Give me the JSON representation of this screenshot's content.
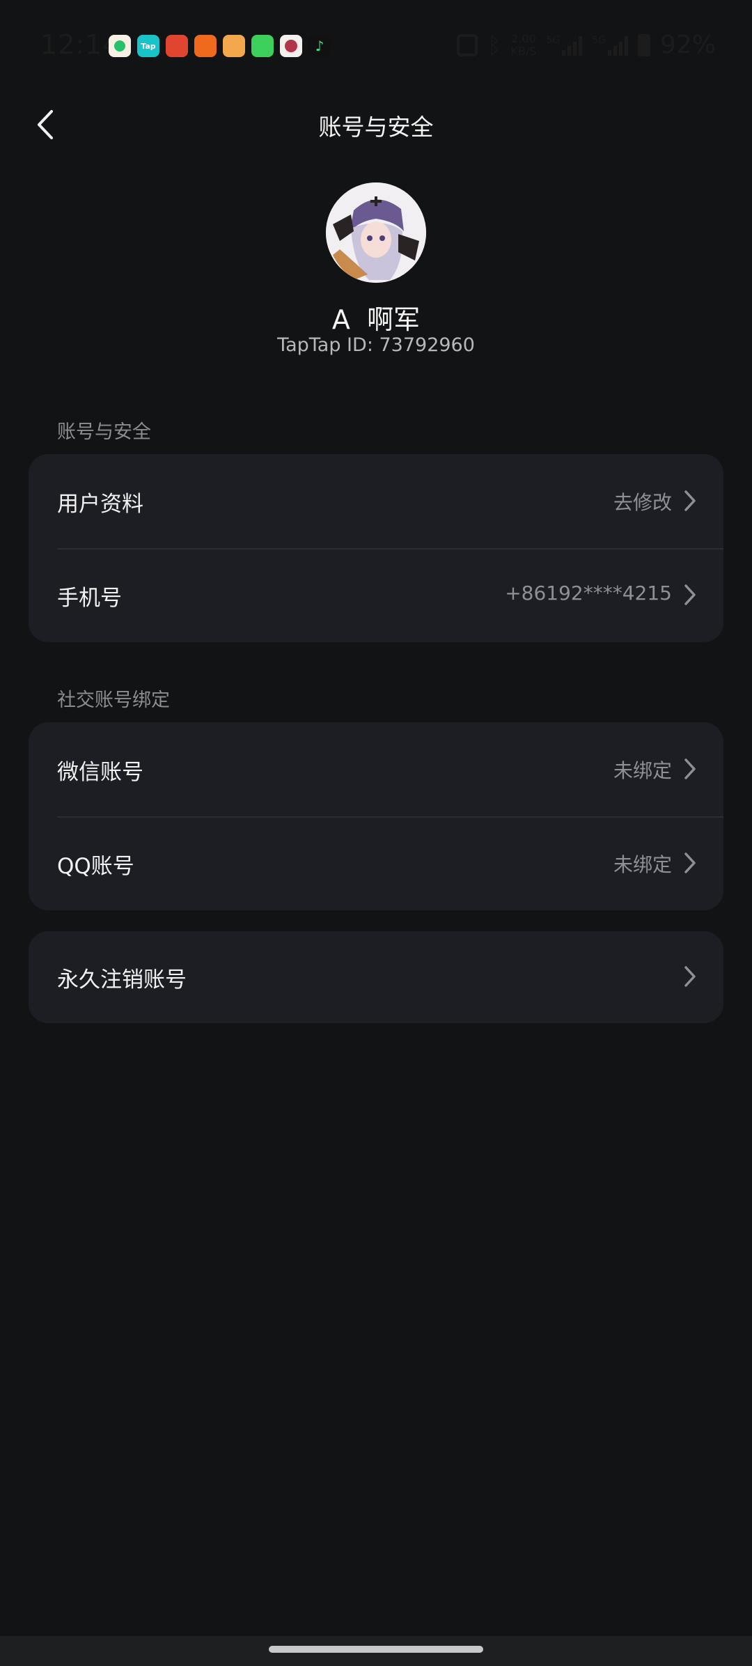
{
  "status_bar": {
    "time": "12:14",
    "network_speed": "2.00",
    "network_speed_unit": "KB/S",
    "sim1_type": "5G",
    "sim2_type": "5G",
    "battery": "92%"
  },
  "header": {
    "title": "账号与安全"
  },
  "profile": {
    "name": "A  啊军",
    "taptap_id": "TapTap ID: 73792960"
  },
  "sections": {
    "account": {
      "label": "账号与安全",
      "items": [
        {
          "label": "用户资料",
          "value": "去修改"
        },
        {
          "label": "手机号",
          "value": "+86192****4215"
        }
      ]
    },
    "social": {
      "label": "社交账号绑定",
      "items": [
        {
          "label": "微信账号",
          "value": "未绑定"
        },
        {
          "label": "QQ账号",
          "value": "未绑定"
        }
      ]
    },
    "delete": {
      "label": "永久注销账号"
    }
  },
  "notification_apps": [
    "Tap"
  ]
}
